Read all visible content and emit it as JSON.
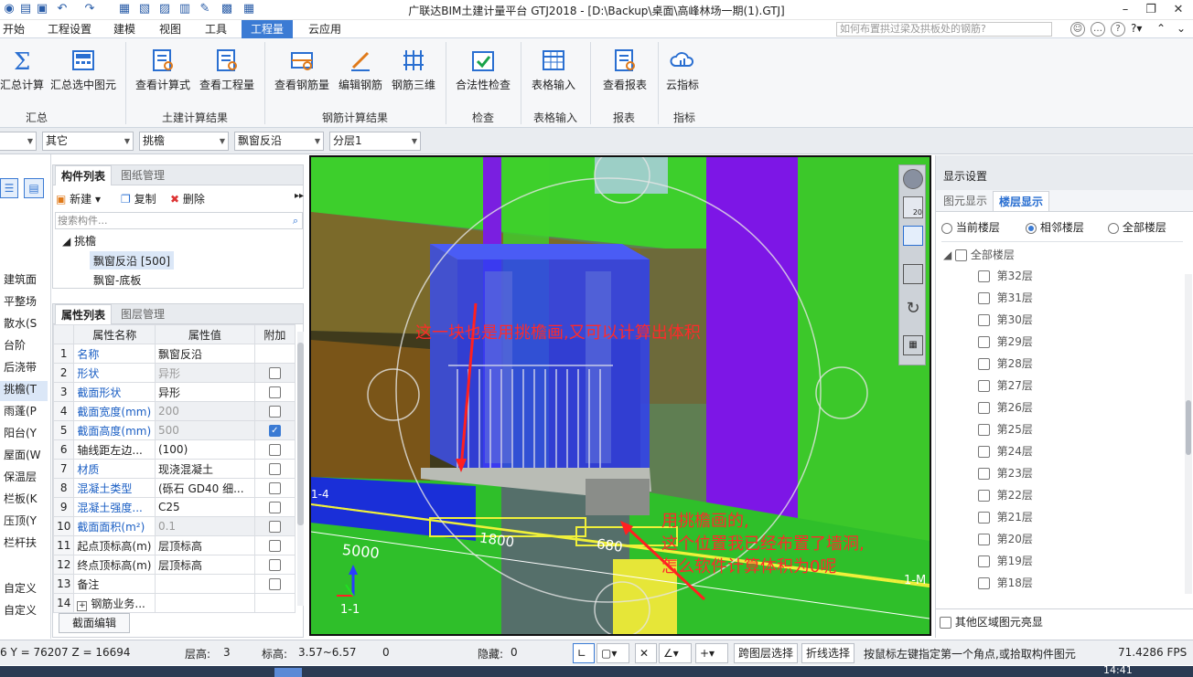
{
  "window": {
    "title": "广联达BIM土建计量平台 GTJ2018 - [D:\\Backup\\桌面\\高峰林场一期(1).GTJ]"
  },
  "menu": [
    "开始",
    "工程设置",
    "建模",
    "视图",
    "工具",
    "工程量",
    "云应用"
  ],
  "menu_active": "工程量",
  "help_search": {
    "placeholder": "如何布置拱过梁及拱板处的钢筋?"
  },
  "ribbon": {
    "buttons": [
      {
        "label": "汇总计算",
        "icon": "sigma-icon"
      },
      {
        "label": "汇总选中图元",
        "icon": "calc-selected-icon"
      },
      {
        "label": "查看计算式",
        "icon": "formula-icon"
      },
      {
        "label": "查看工程量",
        "icon": "quantity-icon"
      },
      {
        "label": "查看钢筋量",
        "icon": "rebar-qty-icon"
      },
      {
        "label": "编辑钢筋",
        "icon": "edit-rebar-icon"
      },
      {
        "label": "钢筋三维",
        "icon": "rebar-3d-icon"
      },
      {
        "label": "合法性检查",
        "icon": "check-icon"
      },
      {
        "label": "表格输入",
        "icon": "table-input-icon"
      },
      {
        "label": "查看报表",
        "icon": "report-icon"
      },
      {
        "label": "云指标",
        "icon": "cloud-icon"
      }
    ],
    "groups": [
      "汇总",
      "土建计算结果",
      "钢筋计算结果",
      "检查",
      "表格输入",
      "报表",
      "指标"
    ]
  },
  "combos": [
    "",
    "其它",
    "挑檐",
    "飘窗反沿",
    "分层1"
  ],
  "left_nav": {
    "items": [
      "建筑面",
      "平整场",
      "散水(S",
      "台阶",
      "后浇带",
      "挑檐(T",
      "雨蓬(P",
      "阳台(Y",
      "屋面(W",
      "保温层",
      "栏板(K",
      "压顶(Y",
      "栏杆扶",
      "自定义",
      "自定义"
    ],
    "selected": "挑檐(T"
  },
  "component_panel": {
    "tabs": [
      "构件列表",
      "图纸管理"
    ],
    "toolbar": {
      "new": "新建",
      "copy": "复制",
      "delete": "删除"
    },
    "search_placeholder": "搜索构件...",
    "tree_root": "挑檐",
    "items": [
      "飘窗反沿 [500]",
      "飘窗-底板"
    ]
  },
  "property_panel": {
    "tabs": [
      "属性列表",
      "图层管理"
    ],
    "headers": [
      "属性名称",
      "属性值",
      "附加"
    ],
    "rows": [
      {
        "n": "1",
        "name": "名称",
        "value": "飘窗反沿",
        "blue": true,
        "gray": false,
        "cb": "none"
      },
      {
        "n": "2",
        "name": "形状",
        "value": "异形",
        "blue": true,
        "gray": true,
        "cb": "off"
      },
      {
        "n": "3",
        "name": "截面形状",
        "value": "异形",
        "blue": true,
        "gray": false,
        "cb": "off"
      },
      {
        "n": "4",
        "name": "截面宽度(mm)",
        "value": "200",
        "blue": true,
        "gray": true,
        "cb": "off"
      },
      {
        "n": "5",
        "name": "截面高度(mm)",
        "value": "500",
        "blue": true,
        "gray": true,
        "cb": "on"
      },
      {
        "n": "6",
        "name": "轴线距左边...",
        "value": "(100)",
        "blue": false,
        "gray": false,
        "cb": "off"
      },
      {
        "n": "7",
        "name": "材质",
        "value": "现浇混凝土",
        "blue": true,
        "gray": false,
        "cb": "off"
      },
      {
        "n": "8",
        "name": "混凝土类型",
        "value": "(砾石 GD40 细...",
        "blue": true,
        "gray": false,
        "cb": "off"
      },
      {
        "n": "9",
        "name": "混凝土强度...",
        "value": "C25",
        "blue": true,
        "gray": false,
        "cb": "off"
      },
      {
        "n": "10",
        "name": "截面面积(m²)",
        "value": "0.1",
        "blue": true,
        "gray": true,
        "cb": "off"
      },
      {
        "n": "11",
        "name": "起点顶标高(m)",
        "value": "层顶标高",
        "blue": false,
        "gray": false,
        "cb": "off"
      },
      {
        "n": "12",
        "name": "终点顶标高(m)",
        "value": "层顶标高",
        "blue": false,
        "gray": false,
        "cb": "off"
      },
      {
        "n": "13",
        "name": "备注",
        "value": "",
        "blue": false,
        "gray": false,
        "cb": "off"
      },
      {
        "n": "14",
        "name": "钢筋业务...",
        "value": "",
        "blue": false,
        "gray": false,
        "cb": "none"
      }
    ],
    "edit_button": "截面编辑"
  },
  "viewport": {
    "annotation1": "这一块也是用挑檐画,又可以计算出体积",
    "annotation2_lines": [
      "用挑檐画的,",
      "这个位置我已经布置了墙洞,",
      "怎么软件计算体积为0呢"
    ],
    "dims": [
      "5000",
      "1800",
      "680"
    ],
    "axis_labels": [
      "1-4",
      "1-1",
      "1-M"
    ],
    "nav_number": "20"
  },
  "display_settings": {
    "title": "显示设置",
    "tabs": [
      "图元显示",
      "楼层显示"
    ],
    "radios": [
      "当前楼层",
      "相邻楼层",
      "全部楼层"
    ],
    "radio_selected": "相邻楼层",
    "tree_root": "全部楼层",
    "floors": [
      "第32层",
      "第31层",
      "第30层",
      "第29层",
      "第28层",
      "第27层",
      "第26层",
      "第25层",
      "第24层",
      "第23层",
      "第22层",
      "第21层",
      "第20层",
      "第19层",
      "第18层"
    ],
    "other_area": "其他区域图元亮显"
  },
  "status": {
    "coords": "6 Y = 76207 Z = 16694",
    "floor_height_label": "层高:",
    "floor_height": "3",
    "elevation_label": "标高:",
    "elevation": "3.57~6.57",
    "zero": "0",
    "hidden_label": "隐藏:",
    "hidden": "0",
    "cross_floor": "跨图层选择",
    "polyline": "折线选择",
    "hint": "按鼠标左键指定第一个角点,或拾取构件图元",
    "fps": "71.4286 FPS"
  },
  "taskbar": {
    "time": "14:41"
  },
  "colors": {
    "accent": "#3b7bd4",
    "annotation": "#ff2a2a"
  }
}
